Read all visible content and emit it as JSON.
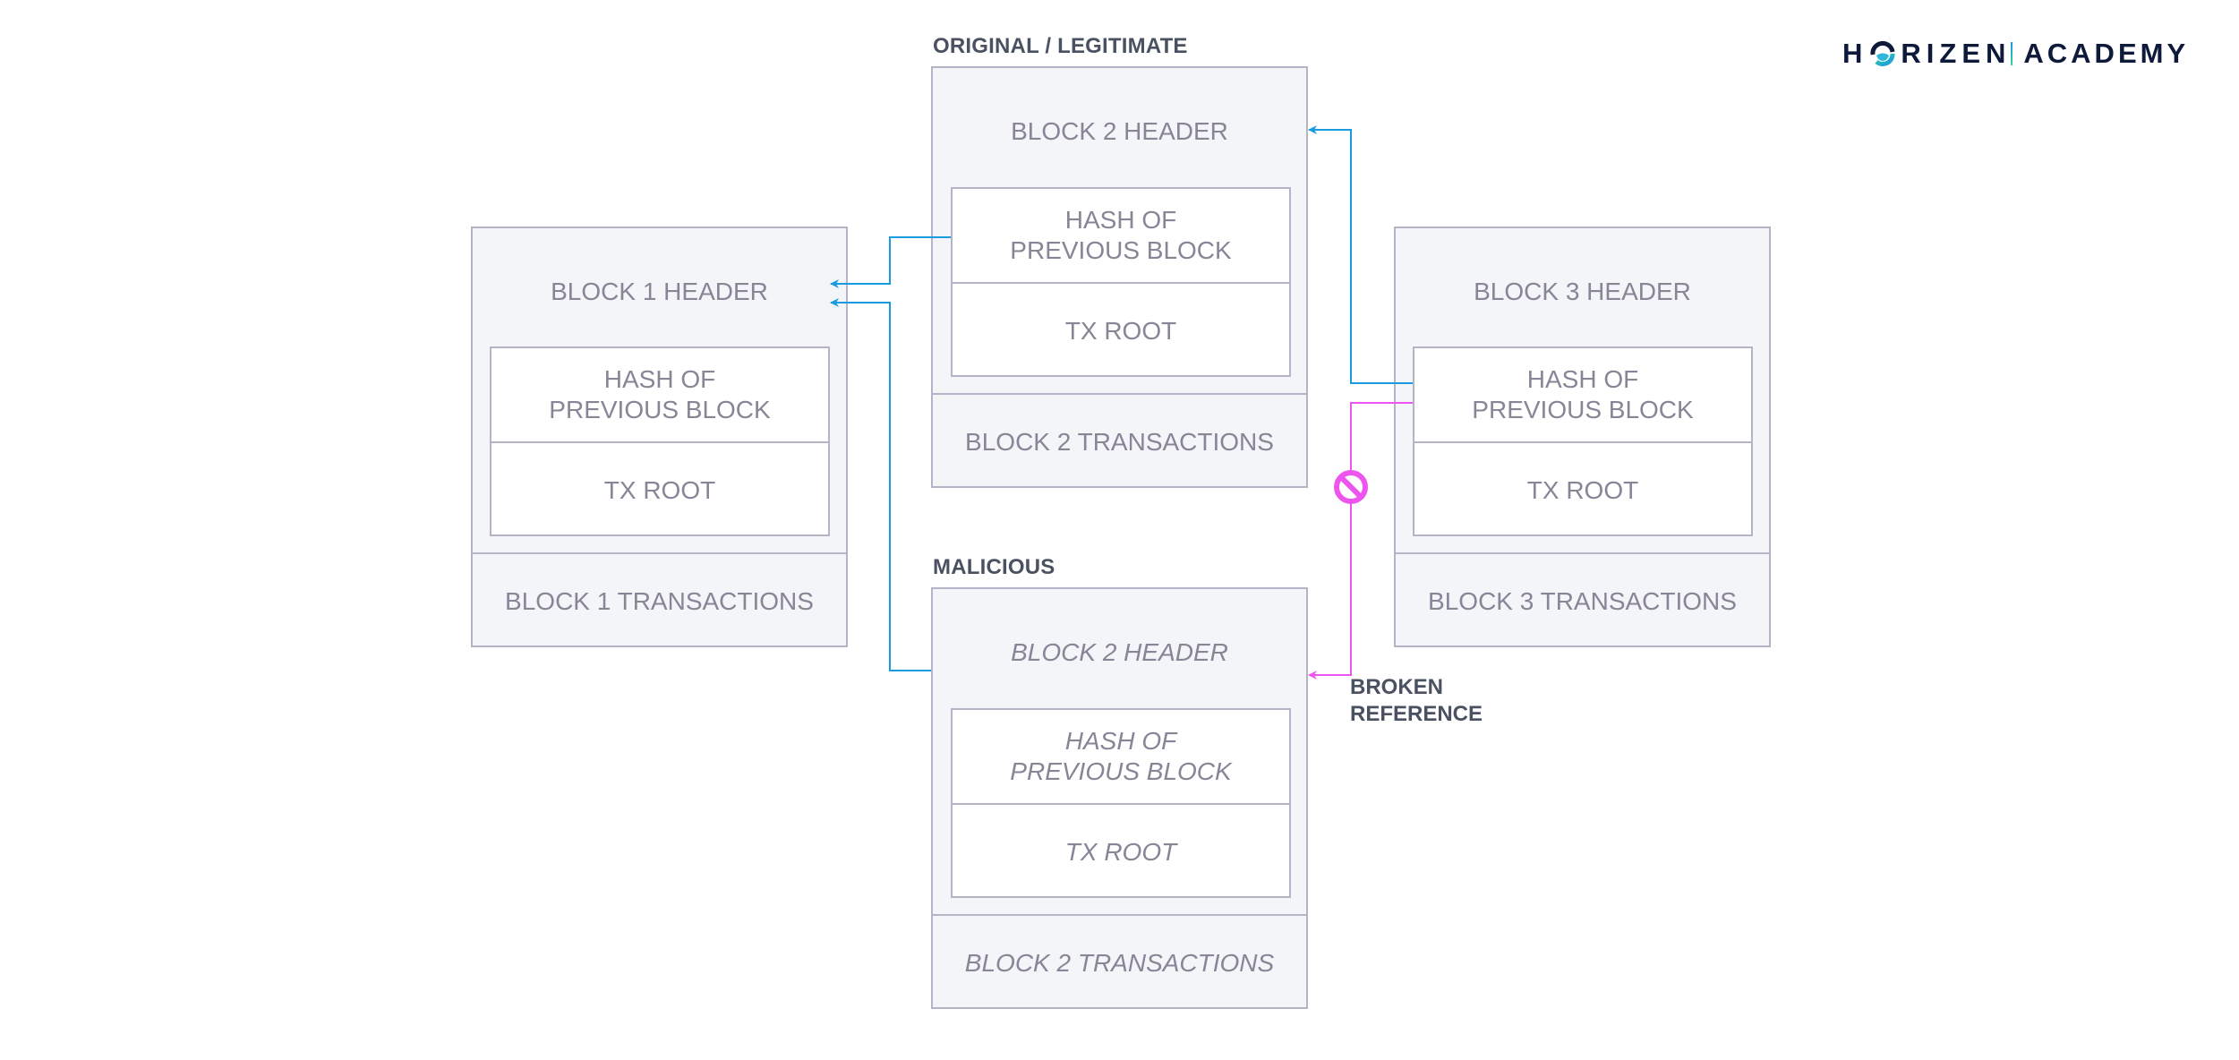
{
  "logo": {
    "brand_pre": "H",
    "brand_post": "RIZEN",
    "product": "ACADEMY",
    "o_icon": "horizen-o-logo-icon"
  },
  "labels": {
    "original": "ORIGINAL / LEGITIMATE",
    "malicious": "MALICIOUS",
    "broken_line1": "BROKEN",
    "broken_line2": "REFERENCE"
  },
  "blocks": {
    "block1": {
      "header": "BLOCK 1 HEADER",
      "hash_line1": "HASH OF",
      "hash_line2": "PREVIOUS BLOCK",
      "tx_root": "TX ROOT",
      "transactions": "BLOCK 1 TRANSACTIONS"
    },
    "block2": {
      "header": "BLOCK 2 HEADER",
      "hash_line1": "HASH OF",
      "hash_line2": "PREVIOUS BLOCK",
      "tx_root": "TX ROOT",
      "transactions": "BLOCK 2 TRANSACTIONS"
    },
    "block2_malicious": {
      "header": "BLOCK 2 HEADER",
      "hash_line1": "HASH OF",
      "hash_line2": "PREVIOUS BLOCK",
      "tx_root": "TX ROOT",
      "transactions": "BLOCK 2 TRANSACTIONS"
    },
    "block3": {
      "header": "BLOCK 3 HEADER",
      "hash_line1": "HASH OF",
      "hash_line2": "PREVIOUS BLOCK",
      "tx_root": "TX ROOT",
      "transactions": "BLOCK 3 TRANSACTIONS"
    }
  },
  "links": [
    {
      "from": "block2.hash",
      "to": "block1.header",
      "status": "valid"
    },
    {
      "from": "block2_malicious.header",
      "to": "block1.header",
      "status": "valid"
    },
    {
      "from": "block3.hash",
      "to": "block2.header",
      "status": "valid"
    },
    {
      "from": "block3.hash",
      "to": "block2_malicious.header",
      "status": "broken"
    }
  ],
  "colors": {
    "valid_link": "#1a9be0",
    "broken_link": "#ee55ee",
    "block_fill": "#f4f5f9",
    "block_border": "#b5b3c6",
    "block_text": "#878596",
    "label_text": "#4a5262",
    "logo_navy": "#0e1a3a"
  }
}
